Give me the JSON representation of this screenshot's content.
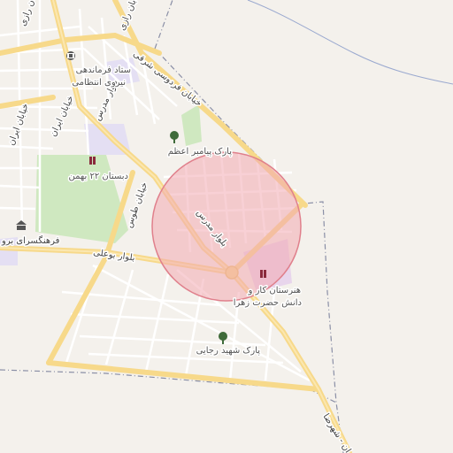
{
  "map": {
    "roads": {
      "modarres": "بلوار مدرس",
      "bouali": "بلوار بوعلی",
      "tous": "خیابان طوس",
      "ferdowsi": "خیابان فردوسی شرقی",
      "razi": "خیابان رازی",
      "chahan": "خیابان رازی",
      "shohada": "ان - شهرضا",
      "farhangsara": "فرهنگسرای برو",
      "left_lbl": "خیابان ایران"
    },
    "pois": {
      "hq_line1": "ستاد فرماندهی",
      "hq_line2": "نیروی انتظامی",
      "park_payambar": "پارک پیامبر اعظم",
      "school_bahman": "دبستان ۲۲ بهمن",
      "school_kar_line1": "هنرستان کار و",
      "school_kar_line2": "دانش حضرت زهرا",
      "park_rajaei": "پارک شهید رجایی"
    },
    "colors": {
      "background": "#f4f1ec",
      "major_road": "#f7d98a",
      "minor_road": "#ffffff",
      "green": "#cfe8c0",
      "lavender": "#e4dff3",
      "highlight_fill": "#f2a9b3",
      "highlight_stroke": "#e0808c",
      "boundary": "#8a8fa6",
      "water": "#9aa9cf"
    },
    "icons": {
      "police": "police-icon",
      "park": "tree-icon",
      "school": "school-icon",
      "museum": "museum-icon"
    }
  }
}
